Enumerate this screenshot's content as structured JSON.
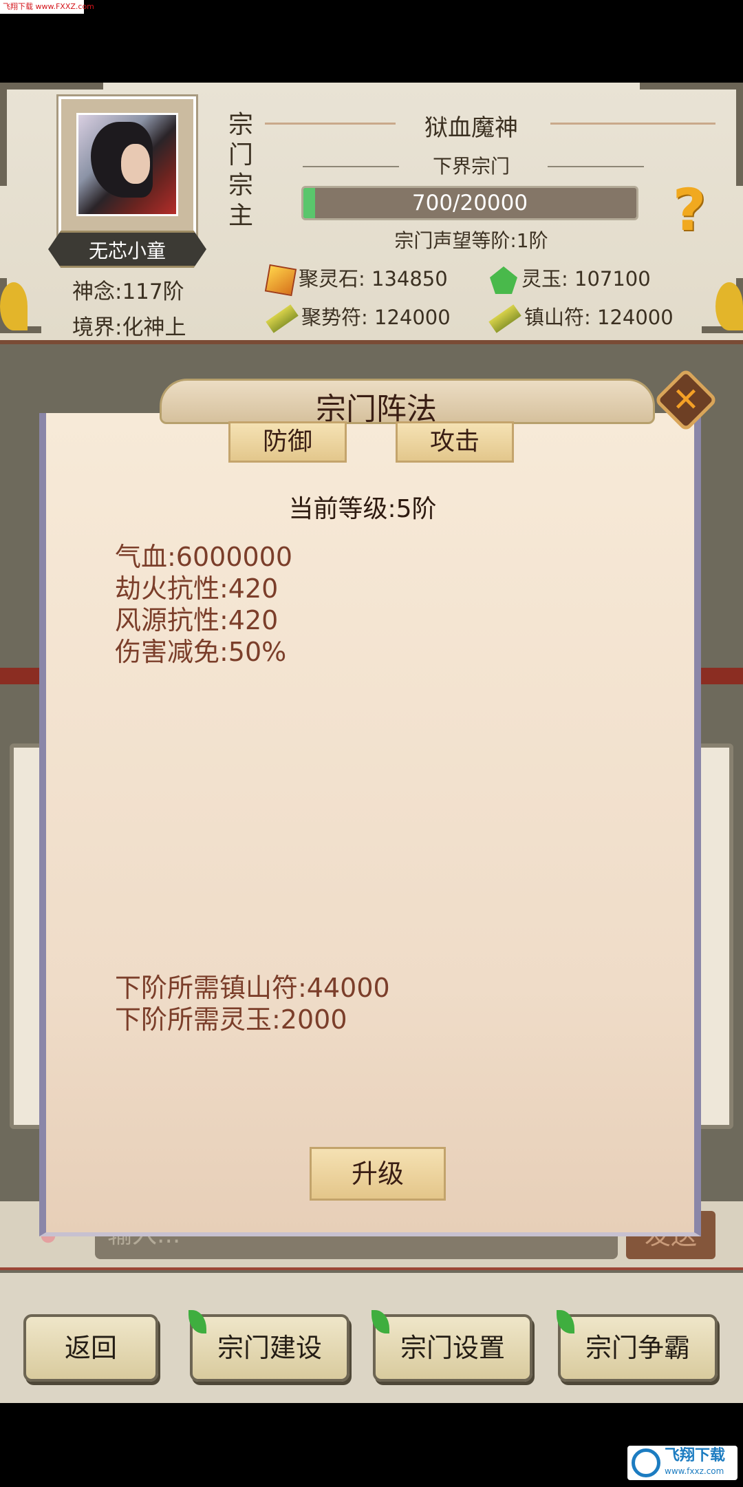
{
  "watermark_top": "飞翔下载 www.FXXZ.com",
  "header": {
    "player_name": "无芯小童",
    "shennian": "神念:117阶",
    "jingjie": "境界:化神上",
    "role_vertical": [
      "宗",
      "门",
      "宗",
      "主"
    ],
    "sect_name": "狱血魔神",
    "sect_tier": "下界宗门",
    "reputation": {
      "current": 700,
      "max": 20000,
      "text": "700/20000"
    },
    "reputation_level": "宗门声望等阶:1阶",
    "help_icon": "?",
    "resources": {
      "juling": "聚灵石: 134850",
      "lingyu": "灵玉: 107100",
      "jushi": "聚势符: 124000",
      "zhenshan": "镇山符: 124000"
    }
  },
  "popup": {
    "title": "宗门阵法",
    "tabs": {
      "defense": "防御",
      "attack": "攻击"
    },
    "current_level": "当前等级:5阶",
    "attributes": [
      "气血:6000000",
      "劫火抗性:420",
      "风源抗性:420",
      "伤害减免:50%"
    ],
    "requirements": [
      "下阶所需镇山符:44000",
      "下阶所需灵玉:2000"
    ],
    "upgrade_label": "升级",
    "close_symbol": "✕"
  },
  "chat": {
    "placeholder": "输入...",
    "send_label": "发送"
  },
  "bottom_nav": {
    "back": "返回",
    "build": "宗门建设",
    "settings": "宗门设置",
    "compete": "宗门争霸"
  },
  "watermark_bottom": {
    "brand": "飞翔下载",
    "url": "www.fxxz.com"
  },
  "colors": {
    "accent_green": "#5ac66c",
    "title_brown": "#3a1e14",
    "attr_brown": "#7b3e2a"
  }
}
